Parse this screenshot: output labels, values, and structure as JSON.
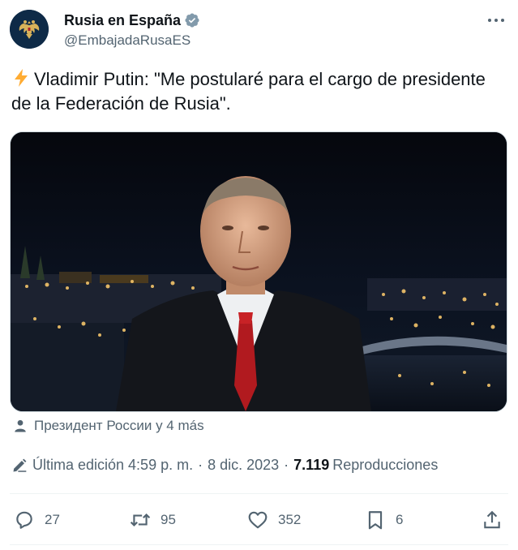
{
  "author": {
    "display_name": "Rusia en España",
    "handle": "@EmbajadaRusaES",
    "verified": true,
    "avatar_icon": "russian-coat-of-arms-icon"
  },
  "tweet": {
    "text": "Vladimir Putin: \"Me postularé para el cargo de presidente de la Federación de Rusia\".",
    "prefix_icon": "lightning-bolt-icon"
  },
  "media": {
    "icon": "night-city-portrait-photo"
  },
  "tagged": {
    "text": "Президент России y 4 más",
    "icon": "person-icon"
  },
  "meta": {
    "edited_label": "Última edición 4:59 p. m.",
    "separator": "·",
    "date": "8 dic. 2023",
    "views_count": "7.119",
    "views_label": "Reproducciones"
  },
  "actions": {
    "replies": "27",
    "retweets": "95",
    "likes": "352",
    "bookmarks": "6"
  },
  "colors": {
    "text_primary": "#0f1419",
    "text_secondary": "#536471",
    "verified_badge": "#829aab",
    "divider": "#eff3f4",
    "bolt": "#ffac33"
  }
}
